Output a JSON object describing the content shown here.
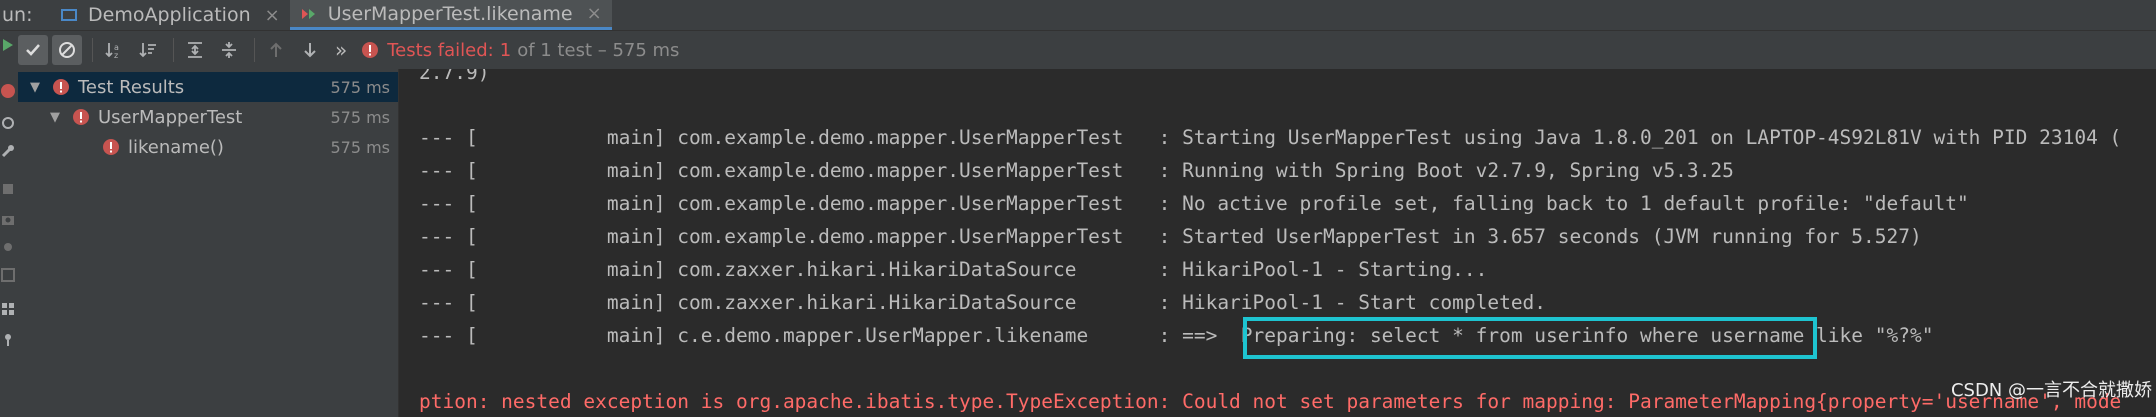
{
  "tabbar": {
    "run_label": "un:",
    "tabs": [
      {
        "label": "DemoApplication",
        "close": "×"
      },
      {
        "label": "UserMapperTest.likename",
        "close": "×"
      }
    ]
  },
  "toolbar": {
    "more": "»",
    "status_failed": "Tests failed:",
    "status_count": "1",
    "status_rest": "of 1 test – 575 ms"
  },
  "tree": {
    "items": [
      {
        "label": "Test Results",
        "duration": "575 ms",
        "expanded": true,
        "selected": true
      },
      {
        "label": "UserMapperTest",
        "duration": "575 ms",
        "expanded": true,
        "selected": false
      },
      {
        "label": "likename()",
        "duration": "575 ms",
        "expanded": false,
        "selected": false
      }
    ]
  },
  "console": {
    "lines": [
      "2.7.9)",
      "",
      "--- [           main] com.example.demo.mapper.UserMapperTest   : Starting UserMapperTest using Java 1.8.0_201 on LAPTOP-4S92L81V with PID 23104 (",
      "--- [           main] com.example.demo.mapper.UserMapperTest   : Running with Spring Boot v2.7.9, Spring v5.3.25",
      "--- [           main] com.example.demo.mapper.UserMapperTest   : No active profile set, falling back to 1 default profile: \"default\"",
      "--- [           main] com.example.demo.mapper.UserMapperTest   : Started UserMapperTest in 3.657 seconds (JVM running for 5.527)",
      "--- [           main] com.zaxxer.hikari.HikariDataSource       : HikariPool-1 - Starting...",
      "--- [           main] com.zaxxer.hikari.HikariDataSource       : HikariPool-1 - Start completed.",
      "--- [           main] c.e.demo.mapper.UserMapper.likename      : ==>  Preparing: select * from userinfo where username like \"%?%\"",
      "",
      "ption: nested exception is org.apache.ibatis.type.TypeException: Could not set parameters for mapping: ParameterMapping{property='username', mode"
    ],
    "watermark": "CSDN @一言不合就撒娇"
  },
  "colors": {
    "error_red": "#E05555",
    "console_error": "#FF6B68",
    "highlight_box": "#1EC4D0",
    "selection": "#0D293E"
  }
}
